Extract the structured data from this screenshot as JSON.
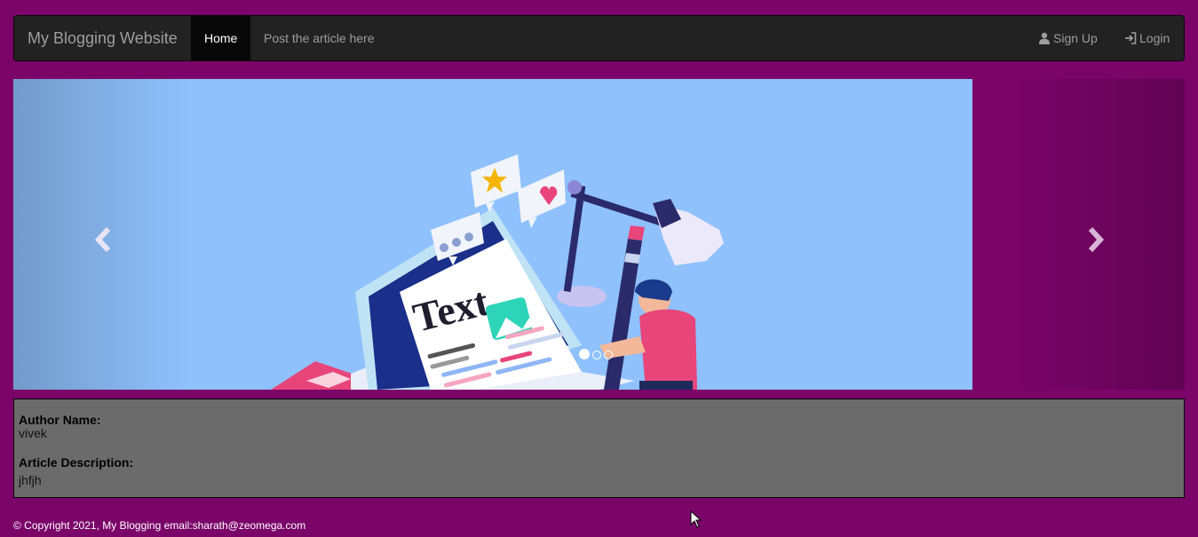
{
  "nav": {
    "brand": "My Blogging Website",
    "home": "Home",
    "post": "Post the article here",
    "signup": "Sign Up",
    "login": "Login"
  },
  "carousel": {
    "image_text": "Text",
    "slide_count": 3,
    "active_slide": 1
  },
  "article": {
    "author_label": "Author Name:",
    "author_value": "vivek",
    "description_label": "Article Description:",
    "description_value": "jhfjh"
  },
  "footer": {
    "text": "© Copyright 2021, My Blogging email:sharath@zeomega.com"
  },
  "colors": {
    "page_background": "#7b0469",
    "navbar": "#222222",
    "slide_background": "#8fc1fc",
    "panel": "#6b6b6b"
  }
}
